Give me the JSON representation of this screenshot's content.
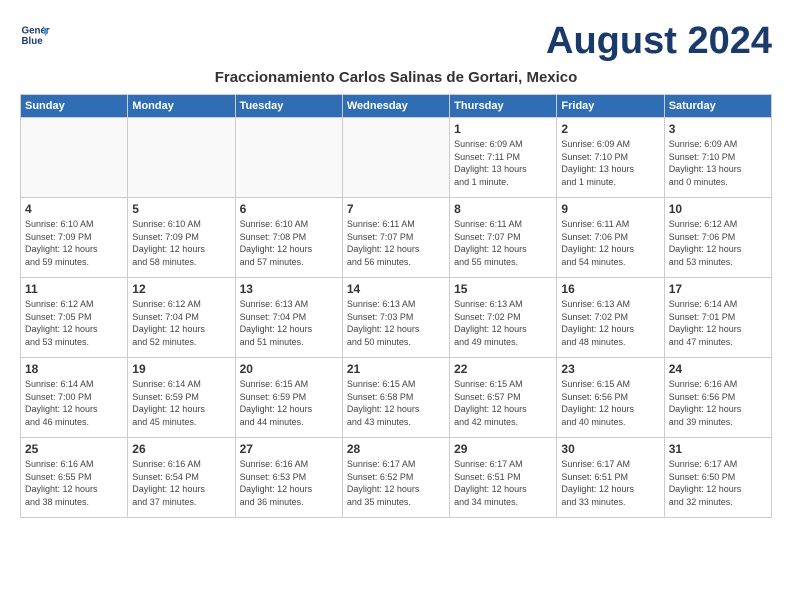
{
  "header": {
    "logo_line1": "General",
    "logo_line2": "Blue",
    "month_year": "August 2024",
    "location": "Fraccionamiento Carlos Salinas de Gortari, Mexico"
  },
  "weekdays": [
    "Sunday",
    "Monday",
    "Tuesday",
    "Wednesday",
    "Thursday",
    "Friday",
    "Saturday"
  ],
  "weeks": [
    [
      {
        "day": "",
        "info": ""
      },
      {
        "day": "",
        "info": ""
      },
      {
        "day": "",
        "info": ""
      },
      {
        "day": "",
        "info": ""
      },
      {
        "day": "1",
        "info": "Sunrise: 6:09 AM\nSunset: 7:11 PM\nDaylight: 13 hours\nand 1 minute."
      },
      {
        "day": "2",
        "info": "Sunrise: 6:09 AM\nSunset: 7:10 PM\nDaylight: 13 hours\nand 1 minute."
      },
      {
        "day": "3",
        "info": "Sunrise: 6:09 AM\nSunset: 7:10 PM\nDaylight: 13 hours\nand 0 minutes."
      }
    ],
    [
      {
        "day": "4",
        "info": "Sunrise: 6:10 AM\nSunset: 7:09 PM\nDaylight: 12 hours\nand 59 minutes."
      },
      {
        "day": "5",
        "info": "Sunrise: 6:10 AM\nSunset: 7:09 PM\nDaylight: 12 hours\nand 58 minutes."
      },
      {
        "day": "6",
        "info": "Sunrise: 6:10 AM\nSunset: 7:08 PM\nDaylight: 12 hours\nand 57 minutes."
      },
      {
        "day": "7",
        "info": "Sunrise: 6:11 AM\nSunset: 7:07 PM\nDaylight: 12 hours\nand 56 minutes."
      },
      {
        "day": "8",
        "info": "Sunrise: 6:11 AM\nSunset: 7:07 PM\nDaylight: 12 hours\nand 55 minutes."
      },
      {
        "day": "9",
        "info": "Sunrise: 6:11 AM\nSunset: 7:06 PM\nDaylight: 12 hours\nand 54 minutes."
      },
      {
        "day": "10",
        "info": "Sunrise: 6:12 AM\nSunset: 7:06 PM\nDaylight: 12 hours\nand 53 minutes."
      }
    ],
    [
      {
        "day": "11",
        "info": "Sunrise: 6:12 AM\nSunset: 7:05 PM\nDaylight: 12 hours\nand 53 minutes."
      },
      {
        "day": "12",
        "info": "Sunrise: 6:12 AM\nSunset: 7:04 PM\nDaylight: 12 hours\nand 52 minutes."
      },
      {
        "day": "13",
        "info": "Sunrise: 6:13 AM\nSunset: 7:04 PM\nDaylight: 12 hours\nand 51 minutes."
      },
      {
        "day": "14",
        "info": "Sunrise: 6:13 AM\nSunset: 7:03 PM\nDaylight: 12 hours\nand 50 minutes."
      },
      {
        "day": "15",
        "info": "Sunrise: 6:13 AM\nSunset: 7:02 PM\nDaylight: 12 hours\nand 49 minutes."
      },
      {
        "day": "16",
        "info": "Sunrise: 6:13 AM\nSunset: 7:02 PM\nDaylight: 12 hours\nand 48 minutes."
      },
      {
        "day": "17",
        "info": "Sunrise: 6:14 AM\nSunset: 7:01 PM\nDaylight: 12 hours\nand 47 minutes."
      }
    ],
    [
      {
        "day": "18",
        "info": "Sunrise: 6:14 AM\nSunset: 7:00 PM\nDaylight: 12 hours\nand 46 minutes."
      },
      {
        "day": "19",
        "info": "Sunrise: 6:14 AM\nSunset: 6:59 PM\nDaylight: 12 hours\nand 45 minutes."
      },
      {
        "day": "20",
        "info": "Sunrise: 6:15 AM\nSunset: 6:59 PM\nDaylight: 12 hours\nand 44 minutes."
      },
      {
        "day": "21",
        "info": "Sunrise: 6:15 AM\nSunset: 6:58 PM\nDaylight: 12 hours\nand 43 minutes."
      },
      {
        "day": "22",
        "info": "Sunrise: 6:15 AM\nSunset: 6:57 PM\nDaylight: 12 hours\nand 42 minutes."
      },
      {
        "day": "23",
        "info": "Sunrise: 6:15 AM\nSunset: 6:56 PM\nDaylight: 12 hours\nand 40 minutes."
      },
      {
        "day": "24",
        "info": "Sunrise: 6:16 AM\nSunset: 6:56 PM\nDaylight: 12 hours\nand 39 minutes."
      }
    ],
    [
      {
        "day": "25",
        "info": "Sunrise: 6:16 AM\nSunset: 6:55 PM\nDaylight: 12 hours\nand 38 minutes."
      },
      {
        "day": "26",
        "info": "Sunrise: 6:16 AM\nSunset: 6:54 PM\nDaylight: 12 hours\nand 37 minutes."
      },
      {
        "day": "27",
        "info": "Sunrise: 6:16 AM\nSunset: 6:53 PM\nDaylight: 12 hours\nand 36 minutes."
      },
      {
        "day": "28",
        "info": "Sunrise: 6:17 AM\nSunset: 6:52 PM\nDaylight: 12 hours\nand 35 minutes."
      },
      {
        "day": "29",
        "info": "Sunrise: 6:17 AM\nSunset: 6:51 PM\nDaylight: 12 hours\nand 34 minutes."
      },
      {
        "day": "30",
        "info": "Sunrise: 6:17 AM\nSunset: 6:51 PM\nDaylight: 12 hours\nand 33 minutes."
      },
      {
        "day": "31",
        "info": "Sunrise: 6:17 AM\nSunset: 6:50 PM\nDaylight: 12 hours\nand 32 minutes."
      }
    ]
  ]
}
